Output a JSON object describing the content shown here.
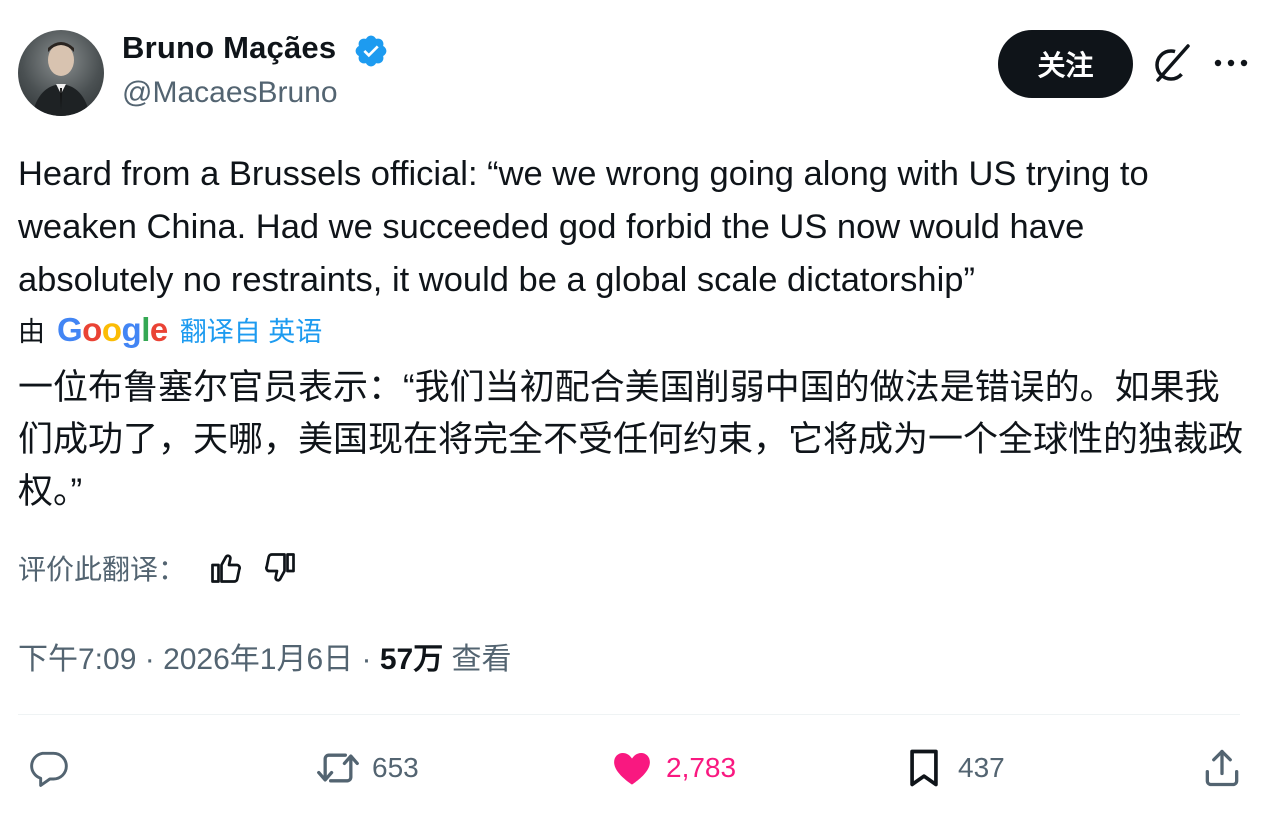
{
  "author": {
    "display_name": "Bruno Maçães",
    "handle": "@MacaesBruno",
    "verified_color": "#1d9bf0"
  },
  "header": {
    "follow_label": "关注",
    "grok_icon": "grok-icon",
    "more_icon": "more-icon"
  },
  "tweet": {
    "text": "Heard from a Brussels official: “we we wrong going along with US trying to weaken China. Had we succeeded god forbid the US now would have absolutely no restraints, it would be a global scale dictatorship”"
  },
  "translation": {
    "by_label": "由",
    "google": [
      "G",
      "o",
      "o",
      "g",
      "l",
      "e"
    ],
    "google_colors": [
      "#4285F4",
      "#EA4335",
      "#FBBC05",
      "#4285F4",
      "#34A853",
      "#EA4335"
    ],
    "link_text": "翻译自 英语",
    "text": "一位布鲁塞尔官员表示：“我们当初配合美国削弱中国的做法是错误的。如果我们成功了，天哪，美国现在将完全不受任何约束，它将成为一个全球性的独裁政权。”",
    "rate_label": "评价此翻译："
  },
  "meta": {
    "time": "下午7:09",
    "separator": " · ",
    "date": "2026年1月6日",
    "views_count": "57万",
    "views_label": " 查看"
  },
  "actions": {
    "replies": "",
    "reposts": "653",
    "likes": "2,783",
    "bookmarks": "437",
    "like_color": "#f91880"
  }
}
